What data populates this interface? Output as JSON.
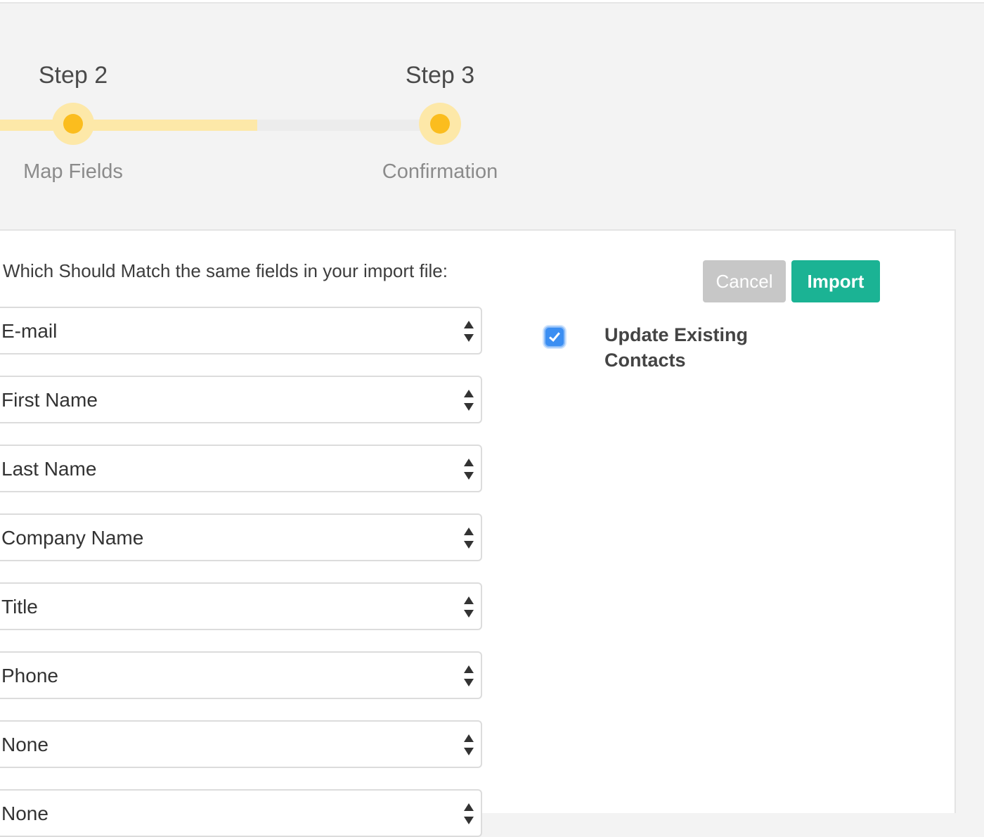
{
  "stepper": {
    "steps": [
      {
        "title": "Step 2",
        "subtitle": "Map Fields",
        "state": "current"
      },
      {
        "title": "Step 3",
        "subtitle": "Confirmation",
        "state": "upcoming"
      }
    ],
    "colors": {
      "track_done": "#fde8a8",
      "dot": "#fbbd1e",
      "track_todo": "#ececec"
    }
  },
  "form": {
    "instruction": "Which Should Match the same fields in your import file:",
    "fields": [
      "E-mail",
      "First Name",
      "Last Name",
      "Company Name",
      "Title",
      "Phone",
      "None",
      "None"
    ]
  },
  "actions": {
    "cancel_label": "Cancel",
    "import_label": "Import",
    "colors": {
      "cancel": "#c7c7c7",
      "import": "#1bb394"
    }
  },
  "options": {
    "update_existing": {
      "label": "Update Existing Contacts",
      "checked": true
    }
  }
}
